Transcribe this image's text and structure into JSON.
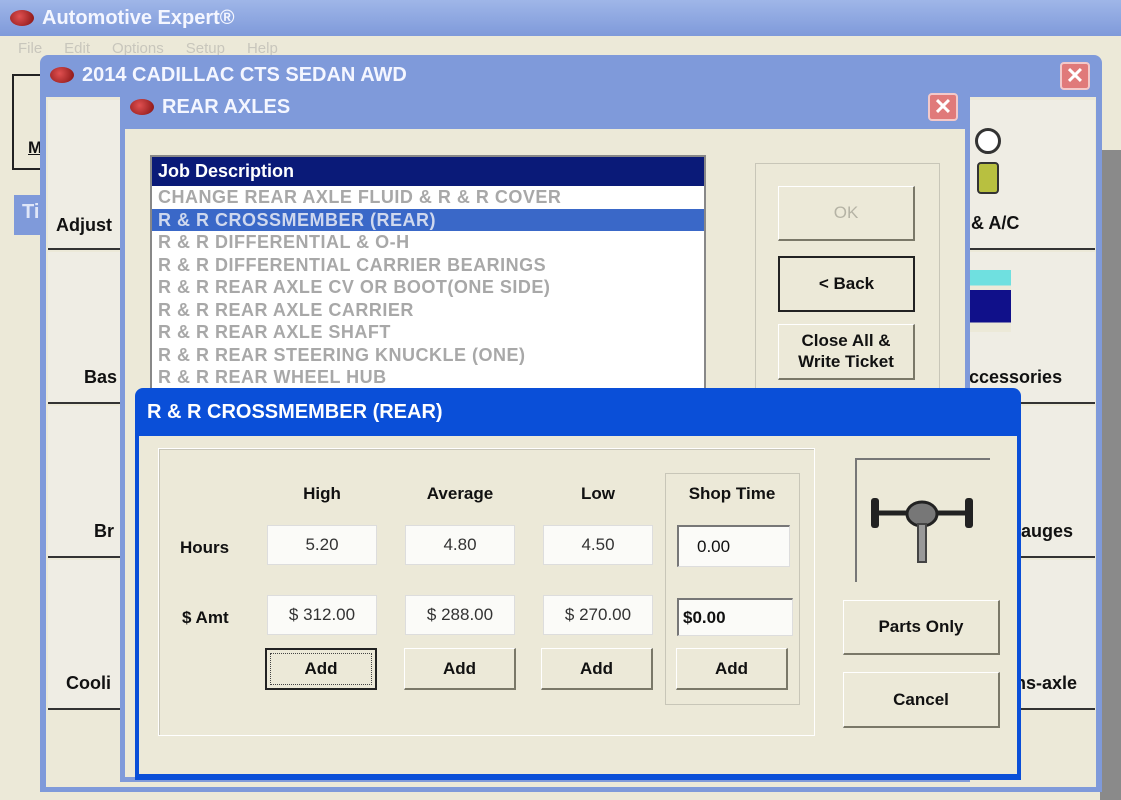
{
  "app": {
    "title": "Automotive Expert®",
    "menu": [
      "File",
      "Edit",
      "Options",
      "Setup",
      "Help"
    ],
    "left_button": "M",
    "tab_fragment": "Ti"
  },
  "vehicle": {
    "title": "2014 CADILLAC CTS SEDAN AWD",
    "left_categories": [
      "Adjust",
      "Bas",
      "Br",
      "Cooli"
    ],
    "right_categories": [
      "& A/C",
      "ccessories",
      "auges",
      "ns-axle"
    ]
  },
  "rear_axles": {
    "title": "REAR AXLES",
    "list_header": "Job Description",
    "selected_index": 1,
    "jobs": [
      "CHANGE REAR AXLE FLUID & R & R COVER",
      "R & R CROSSMEMBER (REAR)",
      "R & R DIFFERENTIAL & O-H",
      "R & R DIFFERENTIAL CARRIER BEARINGS",
      "R & R REAR AXLE CV OR BOOT(ONE SIDE)",
      "R & R REAR AXLE CARRIER",
      "R & R REAR AXLE SHAFT",
      "R & R REAR STEERING KNUCKLE (ONE)",
      "R & R REAR WHEEL HUB"
    ],
    "ok": "OK",
    "back": "< Back",
    "close_all": "Close All & Write Ticket"
  },
  "crossmember": {
    "title": "R & R CROSSMEMBER (REAR)",
    "row_labels": {
      "hours": "Hours",
      "amount": "$ Amt"
    },
    "columns": [
      {
        "label": "High",
        "hours": "5.20",
        "amount": "$ 312.00",
        "add": "Add"
      },
      {
        "label": "Average",
        "hours": "4.80",
        "amount": "$ 288.00",
        "add": "Add"
      },
      {
        "label": "Low",
        "hours": "4.50",
        "amount": "$ 270.00",
        "add": "Add"
      },
      {
        "label": "Shop Time",
        "hours": "0.00",
        "amount": "$0.00",
        "add": "Add"
      }
    ],
    "parts_only": "Parts Only",
    "cancel": "Cancel"
  }
}
